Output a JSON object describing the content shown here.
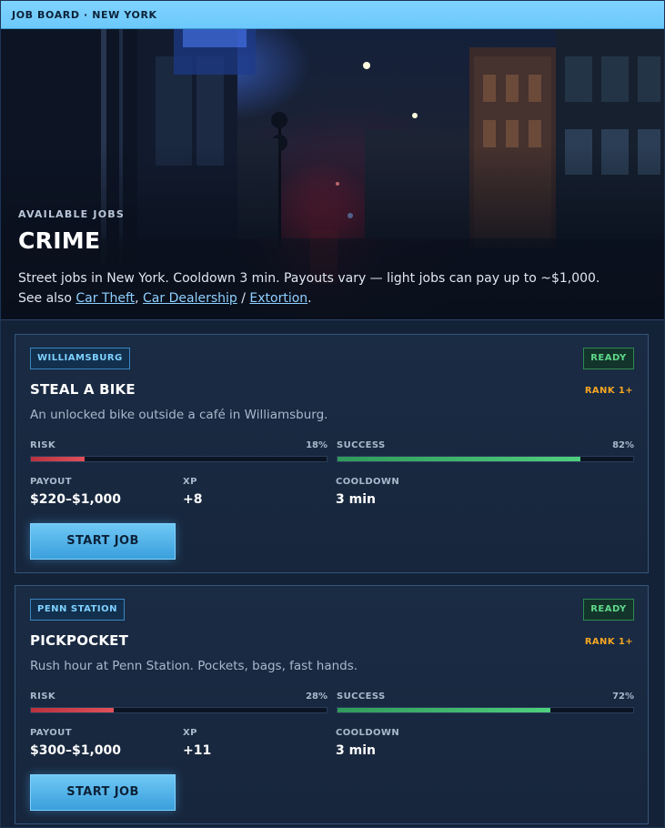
{
  "topbar": {
    "title": "JOB BOARD · NEW YORK"
  },
  "hero": {
    "eyebrow": "AVAILABLE JOBS",
    "title": "CRIME",
    "description": "Street jobs in New York. Cooldown 3 min. Payouts vary — light jobs can pay up to ~$1,000.",
    "see_also_prefix": "See also ",
    "links": [
      "Car Theft",
      "Car Dealership",
      "Extortion"
    ],
    "sep_comma": ", ",
    "sep_slash": " / ",
    "suffix": "."
  },
  "jobs": [
    {
      "location": "WILLIAMSBURG",
      "status": "READY",
      "title": "STEAL A BIKE",
      "rank": "RANK 1+",
      "description": "An unlocked bike outside a café in Williamsburg.",
      "risk_label": "RISK",
      "risk_text": "18%",
      "risk_value": 18,
      "success_label": "SUCCESS",
      "success_text": "82%",
      "success_value": 82,
      "payout_label": "PAYOUT",
      "payout": "$220–$1,000",
      "xp_label": "XP",
      "xp": "+8",
      "cooldown_label": "COOLDOWN",
      "cooldown": "3 min",
      "button": "START JOB"
    },
    {
      "location": "PENN STATION",
      "status": "READY",
      "title": "PICKPOCKET",
      "rank": "RANK 1+",
      "description": "Rush hour at Penn Station. Pockets, bags, fast hands.",
      "risk_label": "RISK",
      "risk_text": "28%",
      "risk_value": 28,
      "success_label": "SUCCESS",
      "success_text": "72%",
      "success_value": 72,
      "payout_label": "PAYOUT",
      "payout": "$300–$1,000",
      "xp_label": "XP",
      "xp": "+11",
      "cooldown_label": "COOLDOWN",
      "cooldown": "3 min",
      "button": "START JOB"
    }
  ]
}
